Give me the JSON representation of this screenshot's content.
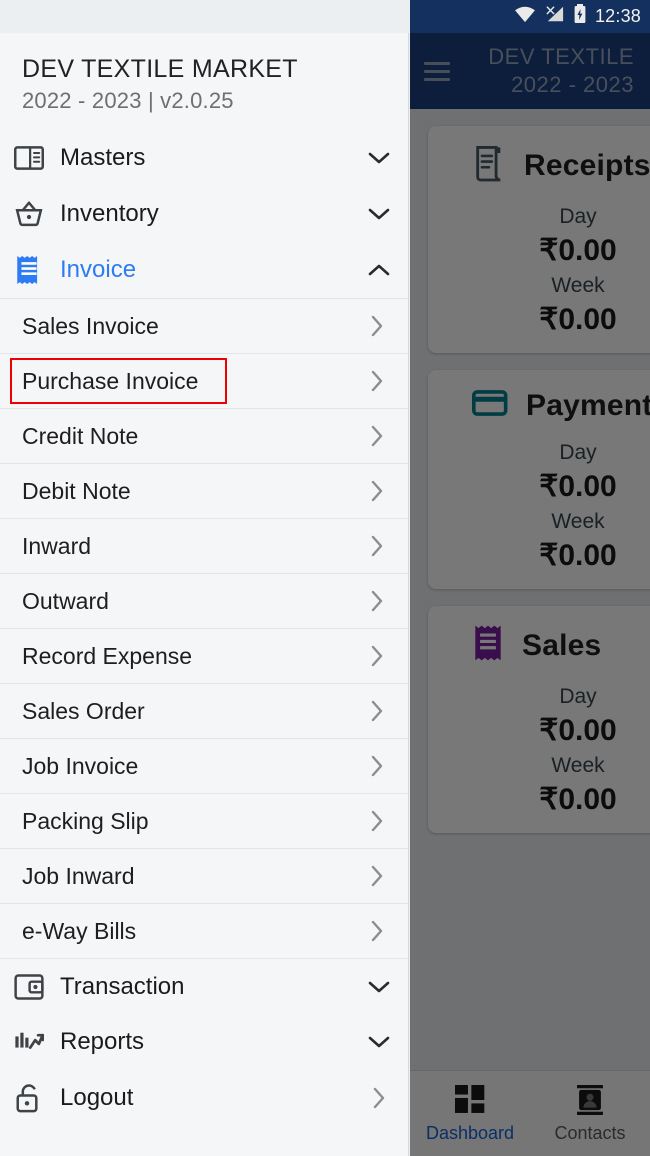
{
  "status_bar": {
    "time": "12:38",
    "icons": [
      "wifi-icon",
      "signal-off-icon",
      "battery-charging-icon"
    ]
  },
  "app_bar": {
    "menu_icon": "hamburger-icon",
    "title_line1": "DEV TEXTILE",
    "title_line2": "2022 - 2023"
  },
  "drawer": {
    "header": {
      "title": "DEV TEXTILE MARKET",
      "subtitle": "2022 - 2023 | v2.0.25"
    },
    "groups": [
      {
        "label": "Masters",
        "icon": "article-icon",
        "chevron": "chevron-down-icon",
        "expanded": false,
        "active": false
      },
      {
        "label": "Inventory",
        "icon": "basket-icon",
        "chevron": "chevron-down-icon",
        "expanded": false,
        "active": false
      },
      {
        "label": "Invoice",
        "icon": "receipt-icon",
        "chevron": "chevron-up-icon",
        "expanded": true,
        "active": true
      }
    ],
    "invoice_items": [
      {
        "label": "Sales Invoice",
        "chevron": "chevron-right-icon",
        "highlighted": false
      },
      {
        "label": "Purchase Invoice",
        "chevron": "chevron-right-icon",
        "highlighted": true
      },
      {
        "label": "Credit Note",
        "chevron": "chevron-right-icon",
        "highlighted": false
      },
      {
        "label": "Debit Note",
        "chevron": "chevron-right-icon",
        "highlighted": false
      },
      {
        "label": "Inward",
        "chevron": "chevron-right-icon",
        "highlighted": false
      },
      {
        "label": "Outward",
        "chevron": "chevron-right-icon",
        "highlighted": false
      },
      {
        "label": "Record Expense",
        "chevron": "chevron-right-icon",
        "highlighted": false
      },
      {
        "label": "Sales Order",
        "chevron": "chevron-right-icon",
        "highlighted": false
      },
      {
        "label": "Job Invoice",
        "chevron": "chevron-right-icon",
        "highlighted": false
      },
      {
        "label": "Packing Slip",
        "chevron": "chevron-right-icon",
        "highlighted": false
      },
      {
        "label": "Job Inward",
        "chevron": "chevron-right-icon",
        "highlighted": false
      },
      {
        "label": "e-Way Bills",
        "chevron": "chevron-right-icon",
        "highlighted": false
      }
    ],
    "bottom_groups": [
      {
        "label": "Transaction",
        "icon": "wallet-icon",
        "chevron": "chevron-down-icon"
      },
      {
        "label": "Reports",
        "icon": "bar-chart-icon",
        "chevron": "chevron-down-icon"
      },
      {
        "label": "Logout",
        "icon": "unlock-icon",
        "chevron": "chevron-right-icon"
      }
    ]
  },
  "dashboard": {
    "cards": [
      {
        "title": "Receipts",
        "icon": "receipt-long-icon",
        "icon_color": "#455a64",
        "day_label": "Day",
        "day_value": "₹0.00",
        "week_label": "Week",
        "week_value": "₹0.00"
      },
      {
        "title": "Payment",
        "icon": "credit-card-icon",
        "icon_color": "#00838f",
        "day_label": "Day",
        "day_value": "₹0.00",
        "week_label": "Week",
        "week_value": "₹0.00"
      },
      {
        "title": "Sales",
        "icon": "receipt-icon",
        "icon_color": "#7b1fa2",
        "day_label": "Day",
        "day_value": "₹0.00",
        "week_label": "Week",
        "week_value": "₹0.00"
      }
    ]
  },
  "bottom_nav": {
    "items": [
      {
        "label": "Dashboard",
        "icon": "dashboard-grid-icon",
        "active": true
      },
      {
        "label": "Contacts",
        "icon": "contact-card-icon",
        "active": false
      }
    ]
  },
  "colors": {
    "status_bar": "#14305e",
    "app_bar": "#1b4180",
    "accent_blue": "#2e7bf6",
    "nav_active": "#1565d8",
    "highlight_box": "#ee0000",
    "drawer_bg": "#f5f6f7",
    "top_band": "#bcbcbc"
  }
}
